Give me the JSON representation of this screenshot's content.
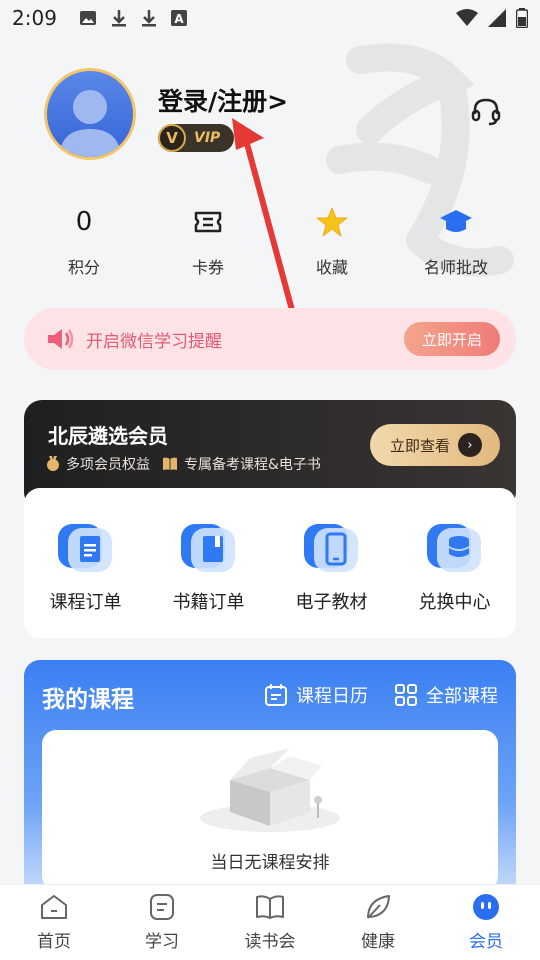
{
  "status_bar": {
    "time": "2:09",
    "icons": [
      "image-icon",
      "download-icon",
      "download-icon",
      "a-icon"
    ],
    "right_icons": [
      "wifi-icon",
      "signal-icon",
      "battery-icon"
    ]
  },
  "profile": {
    "login_text": "登录/注册>",
    "vip_letter": "V",
    "vip_text": "VIP",
    "support_icon": "headset-icon"
  },
  "stats": [
    {
      "value": "0",
      "label": "积分",
      "icon": ""
    },
    {
      "value": "",
      "label": "卡券",
      "icon": "ticket-icon"
    },
    {
      "value": "",
      "label": "收藏",
      "icon": "star-icon"
    },
    {
      "value": "",
      "label": "名师批改",
      "icon": "graduation-cap-icon"
    }
  ],
  "reminder": {
    "text": "开启微信学习提醒",
    "button": "立即开启",
    "icon": "megaphone-icon"
  },
  "membership": {
    "title": "北辰遴选会员",
    "perk1": "多项会员权益",
    "perk2": "专属备考课程&电子书",
    "button": "立即查看"
  },
  "orders": [
    {
      "label": "课程订单",
      "icon": "document-icon"
    },
    {
      "label": "书籍订单",
      "icon": "book-icon"
    },
    {
      "label": "电子教材",
      "icon": "phone-icon"
    },
    {
      "label": "兑换中心",
      "icon": "coins-icon"
    }
  ],
  "courses": {
    "title": "我的课程",
    "calendar_link": "课程日历",
    "all_link": "全部课程",
    "empty_text": "当日无课程安排"
  },
  "tabbar": [
    {
      "label": "首页",
      "icon": "home-icon",
      "active": false
    },
    {
      "label": "学习",
      "icon": "study-icon",
      "active": false
    },
    {
      "label": "读书会",
      "icon": "book-open-icon",
      "active": false
    },
    {
      "label": "健康",
      "icon": "leaf-icon",
      "active": false
    },
    {
      "label": "会员",
      "icon": "member-icon",
      "active": true
    }
  ],
  "colors": {
    "accent": "#2a6ef0",
    "vip_gold": "#e9be62",
    "reminder_pink": "#e35a72",
    "arrow_red": "#e53935"
  }
}
